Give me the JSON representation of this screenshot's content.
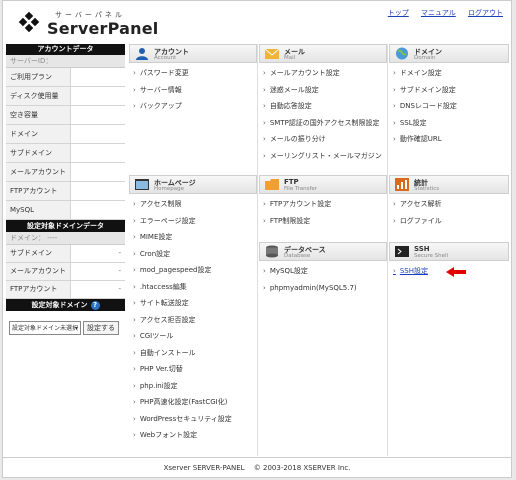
{
  "header": {
    "logo_kana": "サーバーパネル",
    "logo_name": "ServerPanel",
    "links": [
      "トップ",
      "マニュアル",
      "ログアウト"
    ]
  },
  "sidebar": {
    "account_title": "アカウントデータ",
    "server_id": "サーバーID：",
    "account_rows": [
      "ご利用プラン",
      "ディスク使用量",
      "空き容量",
      "ドメイン",
      "サブドメイン",
      "メールアカウント",
      "FTPアカウント",
      "MySQL"
    ],
    "domain_title": "設定対象ドメインデータ",
    "domain_label": "ドメイン： ----",
    "domain_rows": [
      {
        "label": "サブドメイン",
        "value": "-"
      },
      {
        "label": "メールアカウント",
        "value": "-"
      },
      {
        "label": "FTPアカウント",
        "value": "-"
      }
    ],
    "target_title": "設定対象ドメイン",
    "select_value": "設定対象ドメイン未選択",
    "select_button": "設定する"
  },
  "sections": {
    "account": {
      "jp": "アカウント",
      "en": "Account",
      "items": [
        "パスワード変更",
        "サーバー情報",
        "バックアップ"
      ]
    },
    "mail": {
      "jp": "メール",
      "en": "Mail",
      "items": [
        "メールアカウント設定",
        "迷惑メール設定",
        "自動応答設定",
        "SMTP認証の国外アクセス制限設定",
        "メールの振り分け",
        "メーリングリスト・メールマガジン"
      ]
    },
    "domain": {
      "jp": "ドメイン",
      "en": "Domain",
      "items": [
        "ドメイン設定",
        "サブドメイン設定",
        "DNSレコード設定",
        "SSL設定",
        "動作確認URL"
      ]
    },
    "homepage": {
      "jp": "ホームページ",
      "en": "Homepage",
      "items": [
        "アクセス制限",
        "エラーページ設定",
        "MIME設定",
        "Cron設定",
        "mod_pagespeed設定",
        ".htaccess編集",
        "サイト転送設定",
        "アクセス拒否設定",
        "CGIツール",
        "自動インストール",
        "PHP Ver.切替",
        "php.ini設定",
        "PHP高速化設定(FastCGI化)",
        "WordPressセキュリティ設定",
        "Webフォント設定"
      ]
    },
    "ftp": {
      "jp": "FTP",
      "en": "File Transfer",
      "items": [
        "FTPアカウント設定",
        "FTP制限設定"
      ]
    },
    "stats": {
      "jp": "統計",
      "en": "Statistics",
      "items": [
        "アクセス解析",
        "ログファイル"
      ]
    },
    "database": {
      "jp": "データベース",
      "en": "Database",
      "items": [
        "MySQL設定",
        "phpmyadmin(MySQL5.7)"
      ]
    },
    "ssh": {
      "jp": "SSH",
      "en": "Secure Shell",
      "items": [
        "SSH設定"
      ]
    }
  },
  "footer": {
    "text": "Xserver SERVER-PANEL　 © 2003-2018 XSERVER Inc."
  }
}
